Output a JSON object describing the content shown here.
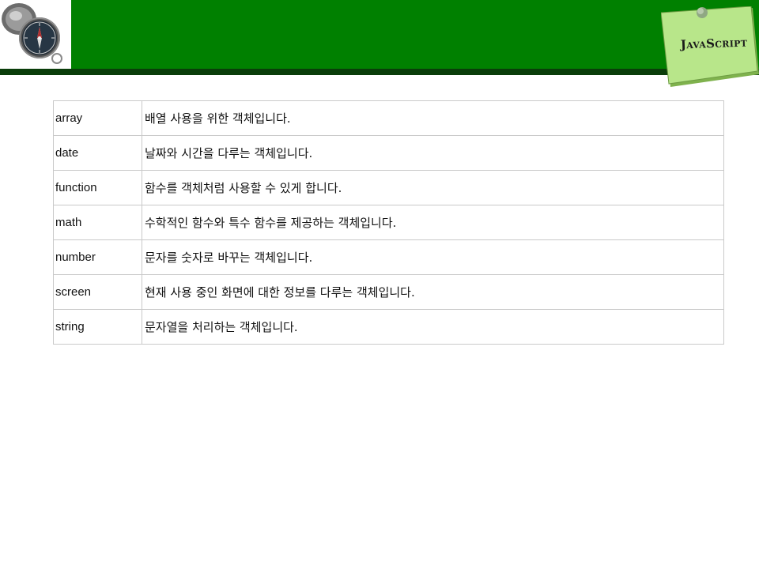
{
  "header": {
    "note_title": "JavaScript",
    "colors": {
      "bar": "#008000",
      "stripe": "#0a3d0a",
      "note": "#b8e68a"
    }
  },
  "objects_table": {
    "rows": [
      {
        "name": "array",
        "description": "배열 사용을 위한 객체입니다."
      },
      {
        "name": "date",
        "description": "날짜와 시간을 다루는 객체입니다."
      },
      {
        "name": "function",
        "description": "함수를 객체처럼 사용할 수 있게 합니다."
      },
      {
        "name": "math",
        "description": "수학적인 함수와 특수 함수를 제공하는 객체입니다."
      },
      {
        "name": "number",
        "description": "문자를 숫자로 바꾸는 객체입니다."
      },
      {
        "name": "screen",
        "description": "현재 사용 중인 화면에 대한 정보를 다루는 객체입니다."
      },
      {
        "name": "string",
        "description": "문자열을 처리하는 객체입니다."
      }
    ]
  }
}
